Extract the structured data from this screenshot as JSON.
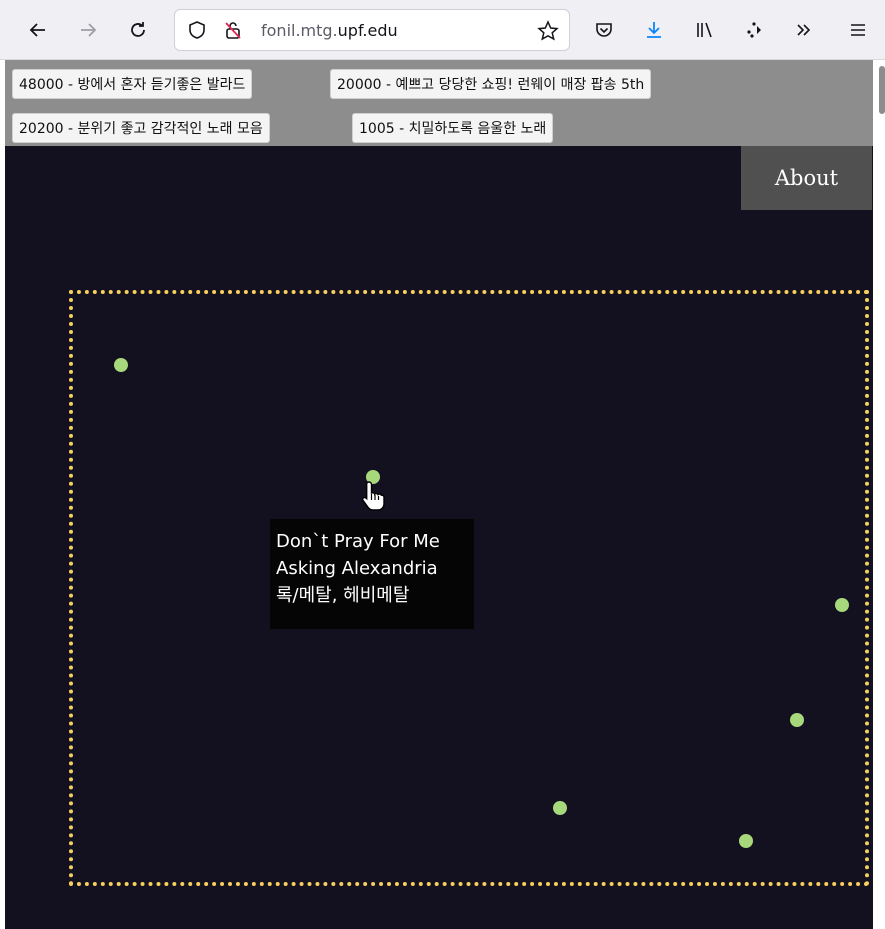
{
  "browser": {
    "url_domain_prefix": "fonil.mtg.",
    "url_domain_main": "upf.edu",
    "icons": [
      "back-arrow-icon",
      "forward-arrow-icon",
      "reload-icon",
      "shield-icon",
      "lock-slash-icon",
      "star-icon",
      "pocket-icon",
      "download-icon",
      "library-icon",
      "extensions-icon",
      "overflow-chevron-icon",
      "menu-icon"
    ],
    "download_color": "#0a84ff"
  },
  "playlists": [
    {
      "label": "48000 - 방에서 혼자 듣기좋은 발라드"
    },
    {
      "label": "20000 - 예쁘고 당당한 쇼핑! 런웨이 매장 팝송 5th"
    },
    {
      "label": "20200 - 분위기 좋고 감각적인 노래 모음"
    },
    {
      "label": "1005 - 치밀하도록 음울한 노래"
    }
  ],
  "nav": {
    "about_label": "About"
  },
  "colors": {
    "background": "#13111f",
    "dot": "#a7d97c",
    "frame": "#f6cf5c",
    "about_bg": "#505050"
  },
  "tooltip": {
    "title": "Don`t Pray For Me",
    "artist": "Asking Alexandria",
    "genre": "록/메탈, 헤비메탈"
  }
}
